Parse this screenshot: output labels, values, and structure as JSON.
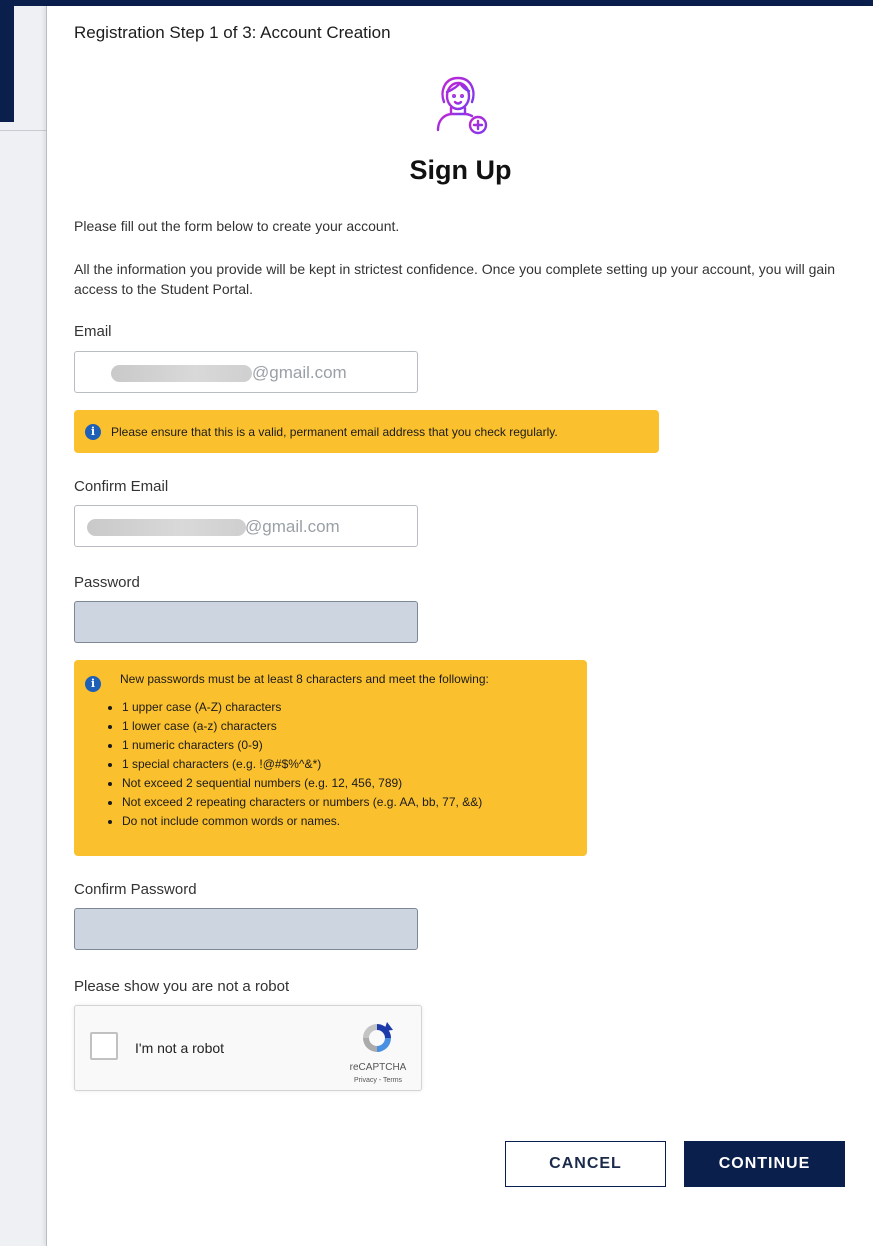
{
  "header": {
    "step_title": "Registration Step 1 of 3: Account Creation"
  },
  "page": {
    "heading": "Sign Up",
    "intro": "Please fill out the form below to create your account.",
    "confidential": "All the information you provide will be kept in strictest confidence. Once you complete setting up your account, you will gain access to the Student Portal.",
    "avatar_icon": "user-add-icon"
  },
  "form": {
    "email": {
      "label": "Email",
      "value_suffix": "@gmail.com",
      "notice": "Please ensure that this is a valid, permanent email address that you check regularly."
    },
    "confirm_email": {
      "label": "Confirm Email",
      "value_suffix": "@gmail.com"
    },
    "password": {
      "label": "Password",
      "rules_intro": "New passwords must be at least 8 characters and meet the following:",
      "rules": [
        "1 upper case (A-Z) characters",
        "1 lower case (a-z) characters",
        "1 numeric characters (0-9)",
        "1 special characters (e.g. !@#$%^&*)",
        "Not exceed 2 sequential numbers (e.g. 12, 456, 789)",
        "Not exceed 2 repeating characters or numbers (e.g. AA, bb, 77, &&)",
        "Do not include common words or names."
      ]
    },
    "confirm_password": {
      "label": "Confirm Password"
    },
    "captcha": {
      "label": "Please show you are not a robot",
      "checkbox_label": "I'm not a robot",
      "brand": "reCAPTCHA",
      "terms": "Privacy - Terms"
    }
  },
  "actions": {
    "cancel": "CANCEL",
    "continue": "CONTINUE"
  },
  "colors": {
    "navy": "#0b1f4d",
    "notice_yellow": "#fbc02d",
    "info_blue": "#1e5fb8",
    "icon_gradient_start": "#c026d3",
    "icon_gradient_end": "#7c3aed"
  }
}
